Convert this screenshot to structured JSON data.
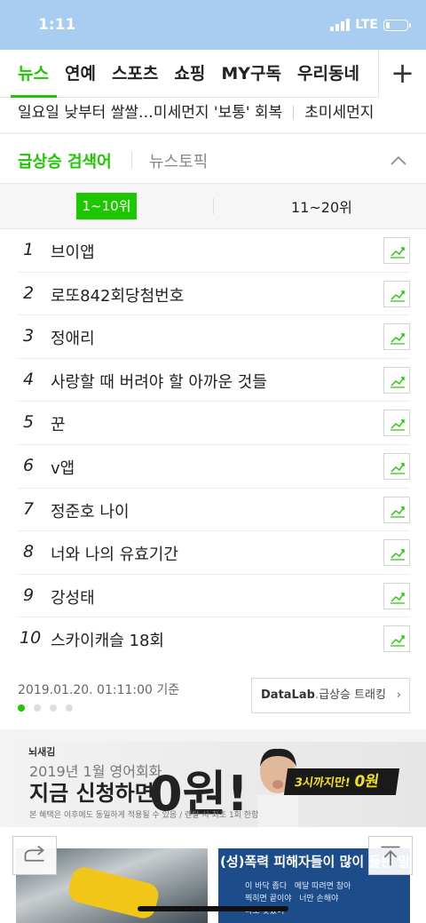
{
  "status": {
    "time": "1:11",
    "network": "LTE"
  },
  "tabs": [
    "뉴스",
    "연예",
    "스포츠",
    "쇼핑",
    "MY구독",
    "우리동네"
  ],
  "tabs_plus": "+",
  "ticker": {
    "headline": "일요일 낮부터 쌀쌀…미세먼지 '보통' 회복",
    "next": "초미세먼지"
  },
  "rank": {
    "title": "급상승 검색어",
    "topic": "뉴스토픽",
    "range_active": "1~10위",
    "range_other": "11~20위",
    "items": [
      {
        "n": "1",
        "kw": "브이앱"
      },
      {
        "n": "2",
        "kw": "로또842회당첨번호"
      },
      {
        "n": "3",
        "kw": "정애리"
      },
      {
        "n": "4",
        "kw": "사랑할 때 버려야 할 아까운 것들"
      },
      {
        "n": "5",
        "kw": "꾼"
      },
      {
        "n": "6",
        "kw": "v앱"
      },
      {
        "n": "7",
        "kw": "정준호 나이"
      },
      {
        "n": "8",
        "kw": "너와 나의 유효기간"
      },
      {
        "n": "9",
        "kw": "강성태"
      },
      {
        "n": "10",
        "kw": "스카이캐슬 18회"
      }
    ],
    "timestamp": "2019.01.20. 01:11:00 기준",
    "datalab_brand": "DataLab",
    "datalab_label": "급상승 트래킹"
  },
  "ad": {
    "brand": "뇌새김",
    "line1": "2019년 1월 영어회화",
    "line2": "지금 신청하면",
    "big": "0원!",
    "badge_text": "3시까지만!",
    "badge_value": "0원",
    "small": "본 혜택은 이후에도 동일하게 적용될 수 있음 / 렌탈 시 최초 1회 한함"
  },
  "news": {
    "caption": "(성)폭력 피해자들이 많이 들는 말",
    "words": [
      "이 바닥 좁다",
      "메달 따려면 참아",
      "찍히면 끝이야",
      "너만 손해야",
      "나도 맞았어"
    ]
  }
}
